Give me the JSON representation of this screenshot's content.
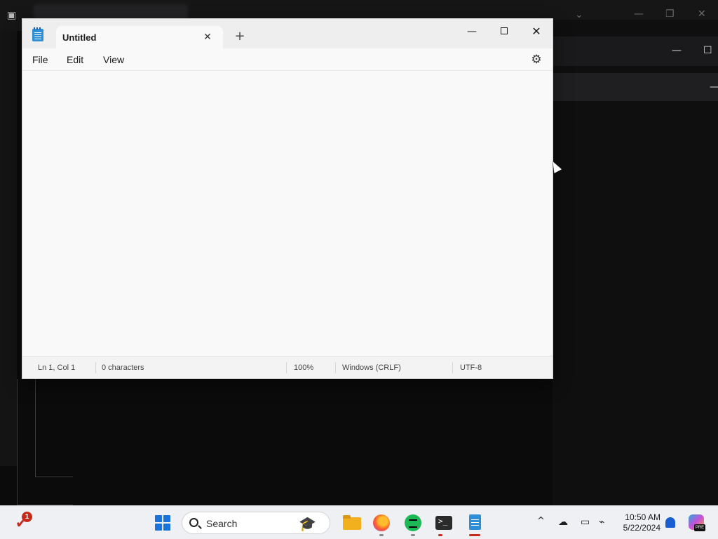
{
  "notepad": {
    "tab_title": "Untitled",
    "tab_close_glyph": "✕",
    "new_tab_glyph": "+",
    "menu": [
      "File",
      "Edit",
      "View"
    ],
    "settings_icon": "gear-icon",
    "window_controls": {
      "minimize_glyph": "—",
      "close_glyph": "✕"
    },
    "editor_content": "",
    "status": {
      "position": "Ln 1, Col 1",
      "characters": "0 characters",
      "zoom": "100%",
      "line_ending": "Windows (CRLF)",
      "encoding": "UTF-8"
    }
  },
  "taskbar": {
    "warning_badge": "1",
    "search_label": "Search",
    "apps": [
      "start",
      "search",
      "file-explorer",
      "firefox",
      "spotify",
      "terminal",
      "notepad"
    ],
    "tray": {
      "chevron_glyph": "^",
      "time": "10:50 AM",
      "date": "5/22/2024"
    },
    "copilot_badge": "PRE"
  },
  "colors": {
    "accent": "#1a73d9",
    "notepad_icon": "#2d8fd8",
    "spotify": "#1db954",
    "alert_red": "#c42b1c"
  }
}
